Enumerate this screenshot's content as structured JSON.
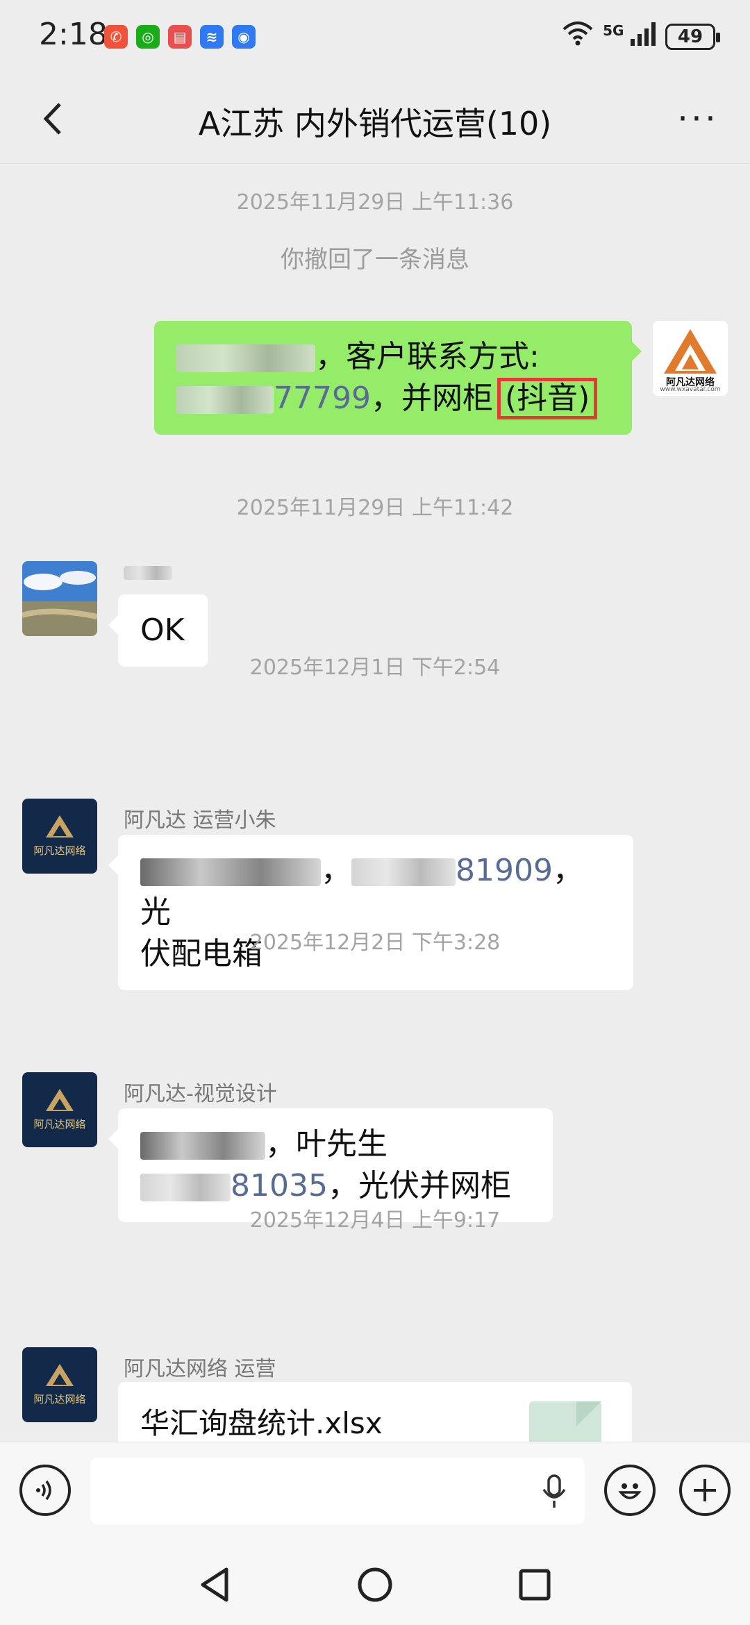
{
  "status": {
    "time": "2:18",
    "network": "5G",
    "battery": "49"
  },
  "header": {
    "title": "A江苏 内外销代运营(10)",
    "more_label": "···"
  },
  "messages": {
    "ts1": "2025年11月29日 上午11:36",
    "recall": "你撤回了一条消息",
    "m1": {
      "text_part1": "，客户联系方式:",
      "phone_tail": "77799",
      "text_part2": "，并网柜",
      "highlight": "(抖音)"
    },
    "ts2": "2025年11月29日 上午11:42",
    "m2": {
      "text": "OK"
    },
    "ts3": "2025年12月1日 下午2:54",
    "m3": {
      "sender": "阿凡达 运营小朱",
      "phone_tail": "81909",
      "text_after": "，光",
      "line2": "伏配电箱"
    },
    "ts4": "2025年12月2日 下午3:28",
    "m4": {
      "sender": "阿凡达-视觉设计",
      "line1_tail": "，叶先生",
      "phone_tail": "81035",
      "line2_tail": "，光伏并网柜"
    },
    "ts5": "2025年12月4日 上午9:17",
    "m5": {
      "sender": "阿凡达网络 运营",
      "filename": "华汇询盘统计.xlsx"
    }
  },
  "avatars": {
    "self_logo_text": "阿凡达网络",
    "self_logo_url": "www.wxavatar.com",
    "group_logo_text": "阿凡达网络"
  }
}
